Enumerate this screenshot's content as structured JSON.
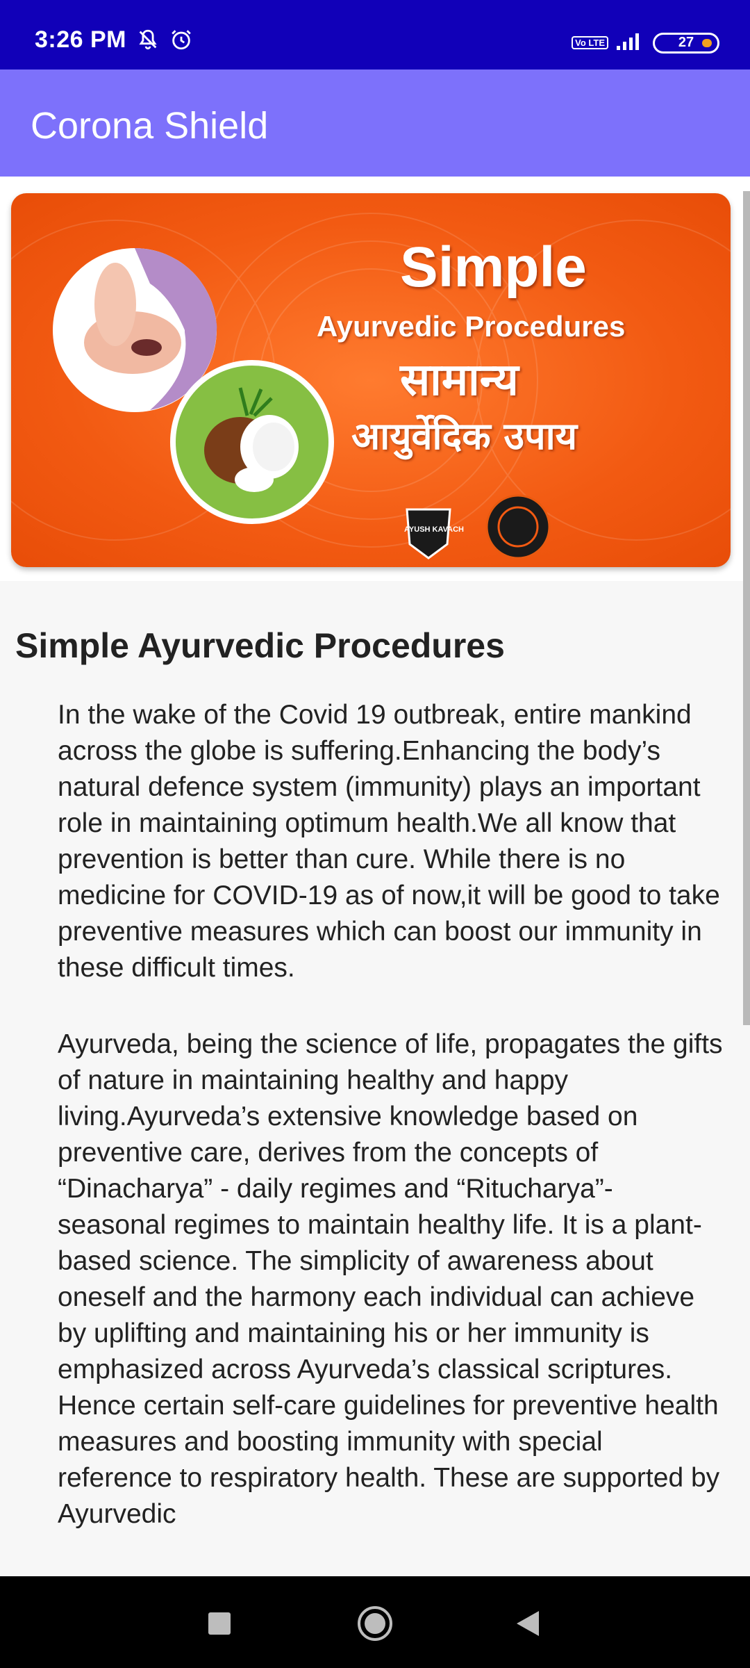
{
  "status_bar": {
    "time": "3:26 PM",
    "network_badge": "Vo LTE",
    "battery_level": "27",
    "icons": [
      "mute-bell-icon",
      "alarm-icon",
      "volte-icon",
      "signal-icon",
      "battery-icon"
    ]
  },
  "app_bar": {
    "title": "Corona Shield"
  },
  "banner": {
    "title": "Simple",
    "subtitle": "Ayurvedic Procedures",
    "hindi_line1": "सामान्य",
    "hindi_line2": "आयुर्वेदिक उपाय",
    "logo_text": "AYUSH KAVACH",
    "colors": {
      "background": "#f25a12"
    }
  },
  "article": {
    "heading": "Simple Ayurvedic Procedures",
    "paragraph1": "In the wake of the Covid 19 outbreak, entire mankind across the globe is suffering.Enhancing the body’s natural defence system (immunity) plays an important role in maintaining optimum health.We all know that prevention is better than cure. While there is no medicine for COVID-19 as of now,it will be good to take preventive measures which can boost our immunity in these difficult times.",
    "paragraph2": "Ayurveda, being the science of life, propagates the gifts of nature in maintaining healthy and happy living.Ayurveda’s extensive knowledge based on preventive care, derives from the concepts of “Dinacharya” - daily regimes and “Ritucharya”- seasonal regimes to maintain healthy life. It is a plant-based science. The simplicity of awareness about oneself and the harmony each individual can achieve by uplifting and maintaining his or her immunity is emphasized across Ayurveda’s classical scriptures. Hence certain self-care guidelines for preventive health measures and boosting immunity with special reference to respiratory health. These are supported by Ayurvedic"
  },
  "nav_bar": {
    "buttons": [
      "recents-square-icon",
      "home-circle-icon",
      "back-triangle-icon"
    ]
  },
  "theme": {
    "status_bar_color": "#1100b8",
    "app_bar_color": "#7d71fb"
  }
}
